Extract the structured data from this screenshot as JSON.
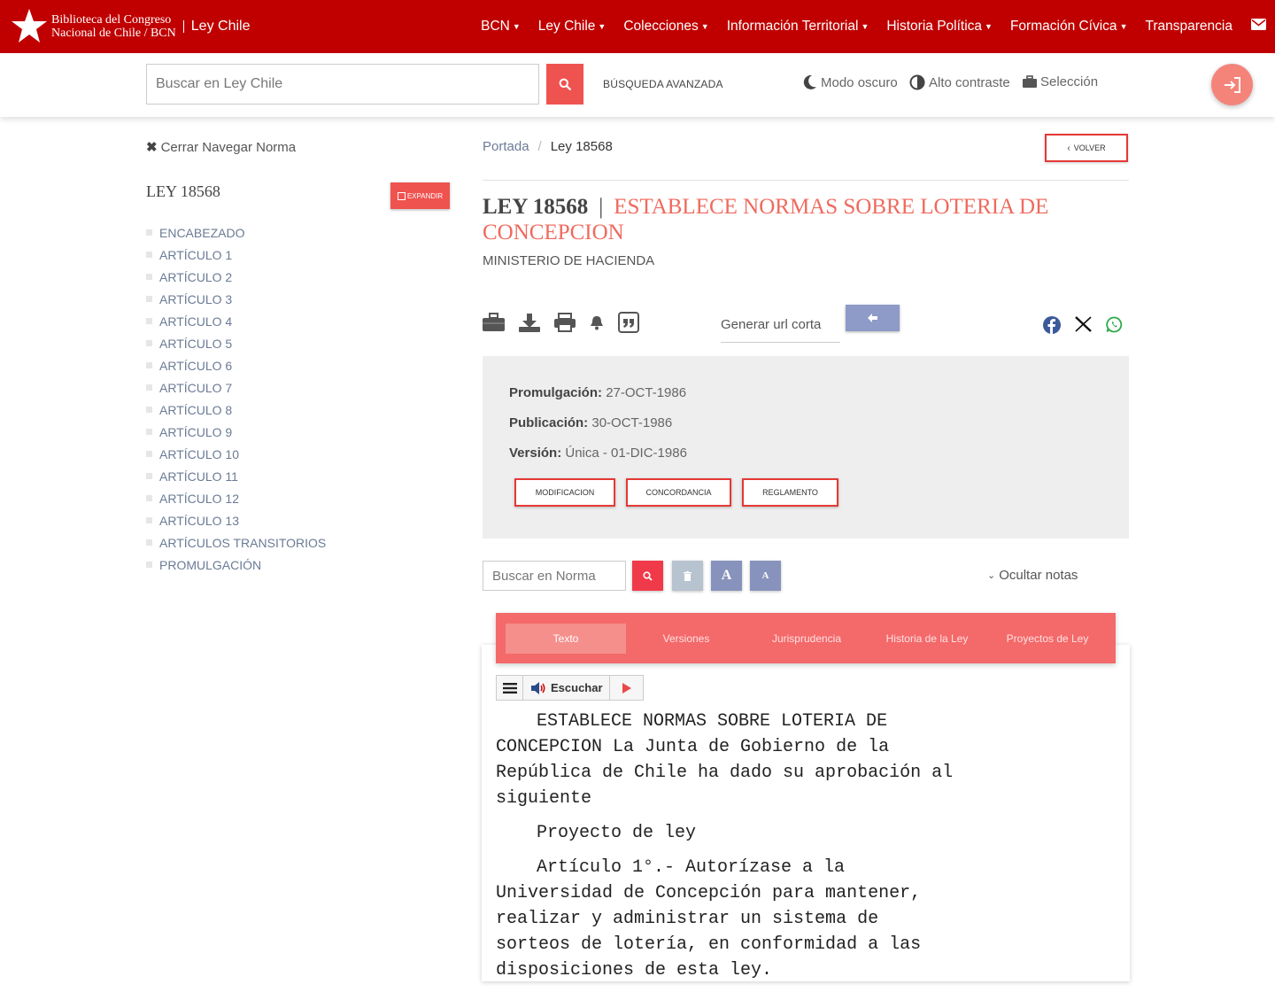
{
  "header": {
    "brand_line1": "Biblioteca del Congreso",
    "brand_line2": "Nacional de Chile / BCN",
    "app_name": "Ley Chile",
    "nav": [
      {
        "label": "BCN"
      },
      {
        "label": "Ley Chile"
      },
      {
        "label": "Colecciones"
      },
      {
        "label": "Información Territorial"
      },
      {
        "label": "Historia Política"
      },
      {
        "label": "Formación Cívica"
      },
      {
        "label": "Transparencia"
      }
    ],
    "colors": {
      "primary": "#c00000",
      "accent": "#ef5350"
    }
  },
  "search": {
    "placeholder": "Buscar en Ley Chile",
    "advanced": "BÚSQUEDA AVANZADA",
    "dark_mode": "Modo oscuro",
    "high_contrast": "Alto contraste",
    "selection": "Selección"
  },
  "sidebar": {
    "close_label": "Cerrar Navegar Norma",
    "law_label": "LEY 18568",
    "expand_label": "EXPANDIR",
    "items": [
      "ENCABEZADO",
      "ARTÍCULO 1",
      "ARTÍCULO 2",
      "ARTÍCULO 3",
      "ARTÍCULO 4",
      "ARTÍCULO 5",
      "ARTÍCULO 6",
      "ARTÍCULO 7",
      "ARTÍCULO 8",
      "ARTÍCULO 9",
      "ARTÍCULO 10",
      "ARTÍCULO 11",
      "ARTÍCULO 12",
      "ARTÍCULO 13",
      "ARTÍCULOS TRANSITORIOS",
      "PROMULGACIÓN"
    ]
  },
  "breadcrumb": {
    "home": "Portada",
    "current": "Ley 18568"
  },
  "back_label": "VOLVER",
  "law": {
    "number": "LEY 18568",
    "title": "ESTABLECE NORMAS SOBRE LOTERIA DE CONCEPCION",
    "ministry": "MINISTERIO DE HACIENDA"
  },
  "short_url": {
    "placeholder": "Generar url corta"
  },
  "info": {
    "promulgacion_label": "Promulgación:",
    "promulgacion_value": "27-OCT-1986",
    "publicacion_label": "Publicación:",
    "publicacion_value": "30-OCT-1986",
    "version_label": "Versión:",
    "version_value": "Única - 01-DIC-1986",
    "buttons": [
      "MODIFICACION",
      "CONCORDANCIA",
      "REGLAMENTO"
    ]
  },
  "norm_search": {
    "placeholder": "Buscar en Norma",
    "hide_notes": "Ocultar notas"
  },
  "tabs": [
    "Texto",
    "Versiones",
    "Jurisprudencia",
    "Historia de la Ley",
    "Proyectos de Ley"
  ],
  "reader": {
    "listen": "Escuchar"
  },
  "text": {
    "p1": "ESTABLECE NORMAS SOBRE LOTERIA DE CONCEPCION La Junta de Gobierno de la República de Chile ha dado su aprobación al siguiente",
    "p2": "Proyecto de ley",
    "p3": "Artículo 1°.- Autorízase a la Universidad de Concepción para mantener, realizar y administrar un sistema de sorteos de lotería, en conformidad a las disposiciones de esta ley."
  }
}
